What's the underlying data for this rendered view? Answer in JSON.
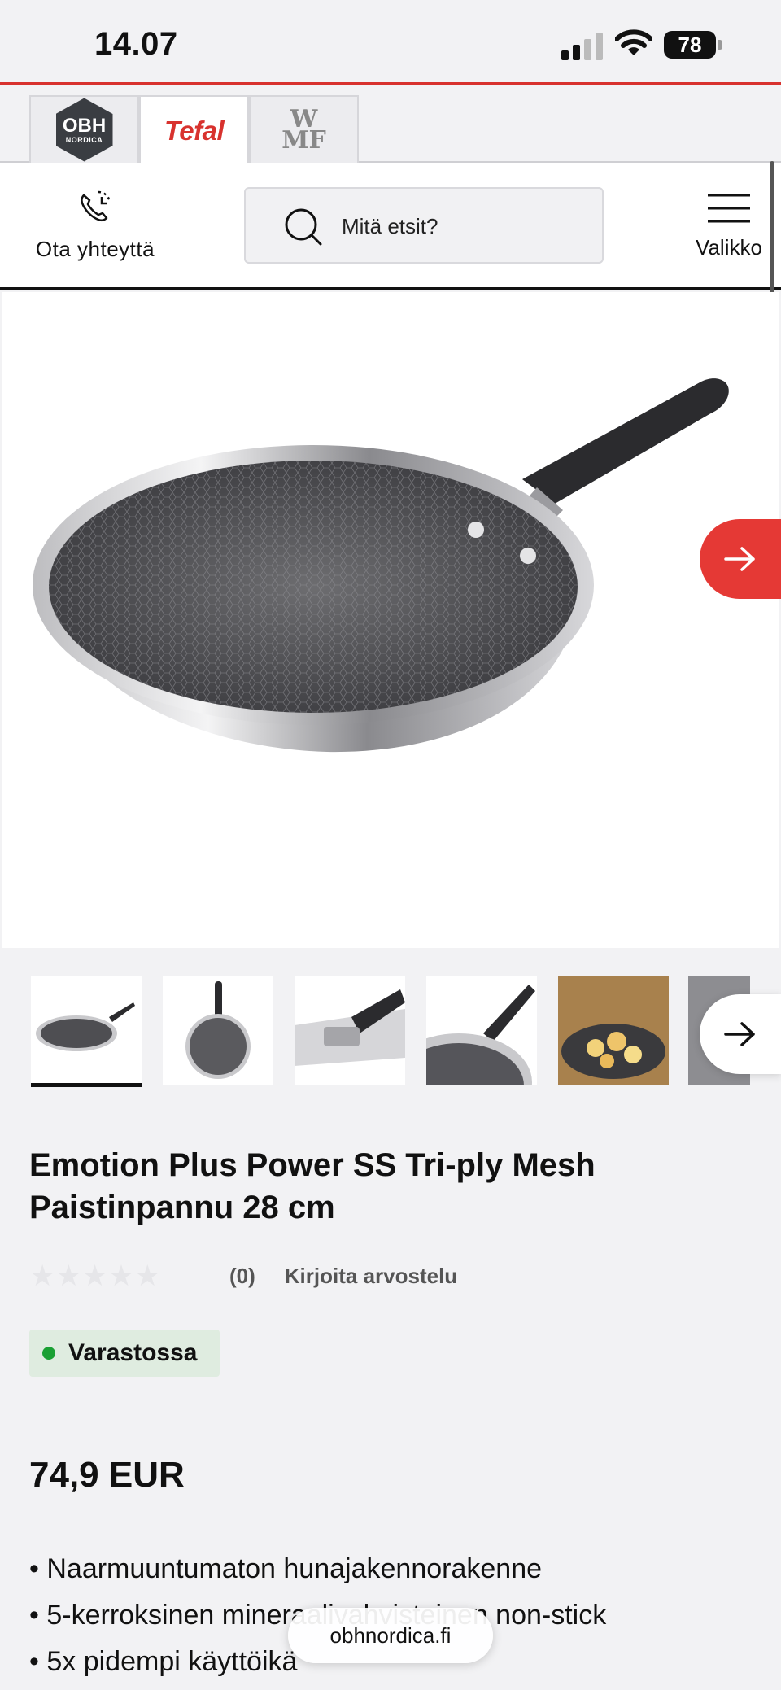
{
  "status_bar": {
    "time": "14.07",
    "battery": "78"
  },
  "brands": {
    "items": [
      {
        "line1": "OBH",
        "line2": "NORDICA"
      },
      {
        "label": "Tefal"
      },
      {
        "line1": "W",
        "line2": "MF"
      }
    ],
    "active": "Tefal"
  },
  "header": {
    "contact_label": "Ota yhteyttä",
    "search_placeholder": "Mitä etsit?",
    "menu_label": "Valikko"
  },
  "product": {
    "title": "Emotion Plus Power SS Tri-ply Mesh Paistinpannu 28 cm",
    "rating_stars": 0,
    "rating_count": "(0)",
    "write_review": "Kirjoita arvostelu",
    "stock": "Varastossa",
    "price": "74,9 EUR",
    "features": [
      "Naarmuuntumaton hunajakennorakenne",
      "5-kerroksinen mineraalivahvisteinen non-stick",
      "5x pidempi käyttöikä"
    ]
  },
  "browser": {
    "url": "obhnordica.fi"
  },
  "colors": {
    "accent": "#d8322e",
    "next_button": "#e53935",
    "in_stock": "#1aa034",
    "in_stock_bg": "#dfece0"
  }
}
